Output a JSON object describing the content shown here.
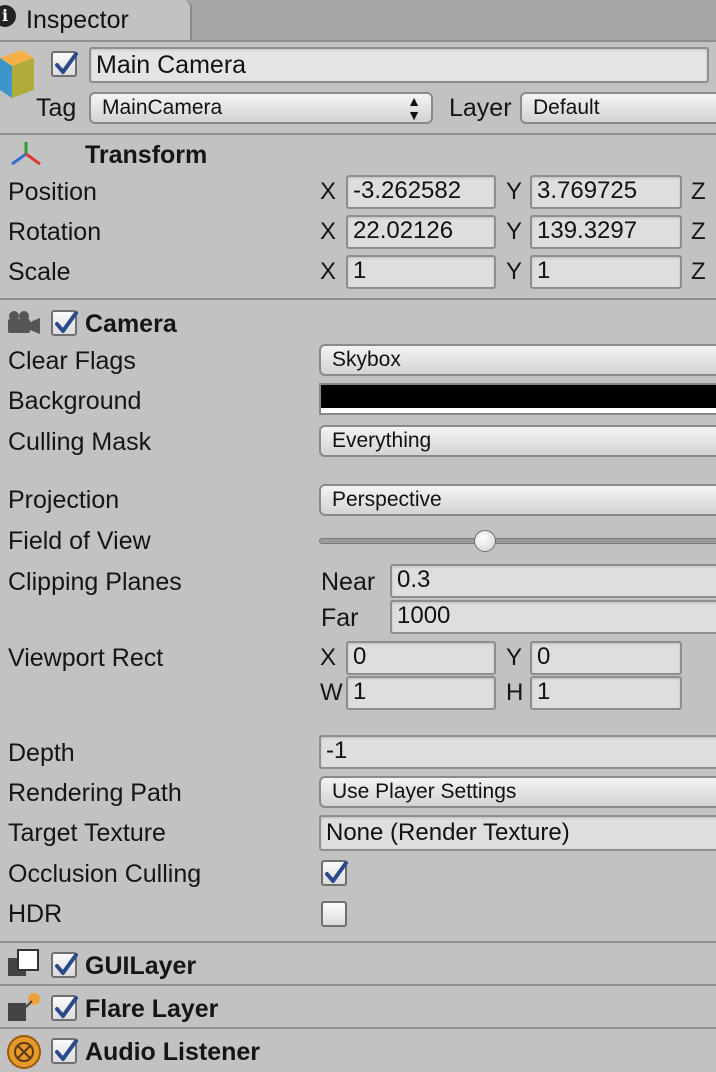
{
  "tab": {
    "title": "Inspector"
  },
  "object": {
    "name": "Main Camera",
    "active": true,
    "tag_label": "Tag",
    "tag_value": "MainCamera",
    "layer_label": "Layer",
    "layer_value": "Default"
  },
  "transform": {
    "title": "Transform",
    "rows": [
      {
        "label": "Position",
        "x": "-3.262582",
        "y": "3.769725"
      },
      {
        "label": "Rotation",
        "x": "22.02126",
        "y": "139.3297"
      },
      {
        "label": "Scale",
        "x": "1",
        "y": "1"
      }
    ],
    "axis_x": "X",
    "axis_y": "Y",
    "axis_z": "Z"
  },
  "camera": {
    "title": "Camera",
    "enabled": true,
    "clear_flags_label": "Clear Flags",
    "clear_flags_value": "Skybox",
    "background_label": "Background",
    "background_color": "#000000",
    "culling_mask_label": "Culling Mask",
    "culling_mask_value": "Everything",
    "projection_label": "Projection",
    "projection_value": "Perspective",
    "fov_label": "Field of View",
    "clipping_label": "Clipping Planes",
    "near_label": "Near",
    "near_value": "0.3",
    "far_label": "Far",
    "far_value": "1000",
    "viewport_label": "Viewport Rect",
    "viewport": {
      "x_label": "X",
      "x": "0",
      "y_label": "Y",
      "y": "0",
      "w_label": "W",
      "w": "1",
      "h_label": "H",
      "h": "1"
    },
    "depth_label": "Depth",
    "depth_value": "-1",
    "rendering_path_label": "Rendering Path",
    "rendering_path_value": "Use Player Settings",
    "target_texture_label": "Target Texture",
    "target_texture_value": "None (Render Texture)",
    "occlusion_label": "Occlusion Culling",
    "occlusion_checked": true,
    "hdr_label": "HDR",
    "hdr_checked": false
  },
  "components": [
    {
      "title": "GUILayer",
      "icon": "guilayer-icon",
      "enabled": true
    },
    {
      "title": "Flare Layer",
      "icon": "flare-layer-icon",
      "enabled": true
    },
    {
      "title": "Audio Listener",
      "icon": "audio-listener-icon",
      "enabled": true
    }
  ],
  "colors": {
    "panel": "#c2c2c2",
    "checkbox_tick": "#2b4a8a"
  }
}
